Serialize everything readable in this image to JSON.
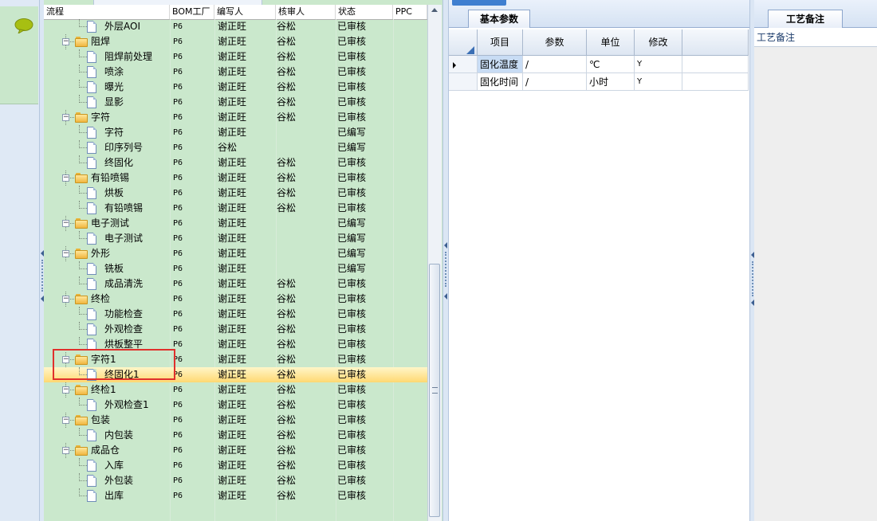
{
  "tree": {
    "columns": [
      "流程",
      "BOM工厂",
      "编写人",
      "核审人",
      "状态",
      "PPC"
    ],
    "rows": [
      {
        "name": "外层AOI",
        "level": 1,
        "type": "doc",
        "bom": "P6",
        "author": "谢正旺",
        "reviewer": "谷松",
        "status": "已审核"
      },
      {
        "name": "阻焊",
        "level": 0,
        "type": "folder",
        "bom": "P6",
        "author": "谢正旺",
        "reviewer": "谷松",
        "status": "已审核"
      },
      {
        "name": "阻焊前处理",
        "level": 1,
        "type": "doc",
        "bom": "P6",
        "author": "谢正旺",
        "reviewer": "谷松",
        "status": "已审核"
      },
      {
        "name": "喷涂",
        "level": 1,
        "type": "doc",
        "bom": "P6",
        "author": "谢正旺",
        "reviewer": "谷松",
        "status": "已审核"
      },
      {
        "name": "曝光",
        "level": 1,
        "type": "doc",
        "bom": "P6",
        "author": "谢正旺",
        "reviewer": "谷松",
        "status": "已审核"
      },
      {
        "name": "显影",
        "level": 1,
        "type": "doc",
        "bom": "P6",
        "author": "谢正旺",
        "reviewer": "谷松",
        "status": "已审核"
      },
      {
        "name": "字符",
        "level": 0,
        "type": "folder",
        "bom": "P6",
        "author": "谢正旺",
        "reviewer": "谷松",
        "status": "已审核"
      },
      {
        "name": "字符",
        "level": 1,
        "type": "doc",
        "bom": "P6",
        "author": "谢正旺",
        "reviewer": "",
        "status": "已编写"
      },
      {
        "name": "印序列号",
        "level": 1,
        "type": "doc",
        "bom": "P6",
        "author": "谷松",
        "reviewer": "",
        "status": "已编写"
      },
      {
        "name": "终固化",
        "level": 1,
        "type": "doc",
        "bom": "P6",
        "author": "谢正旺",
        "reviewer": "谷松",
        "status": "已审核"
      },
      {
        "name": "有铅喷锡",
        "level": 0,
        "type": "folder",
        "bom": "P6",
        "author": "谢正旺",
        "reviewer": "谷松",
        "status": "已审核"
      },
      {
        "name": "烘板",
        "level": 1,
        "type": "doc",
        "bom": "P6",
        "author": "谢正旺",
        "reviewer": "谷松",
        "status": "已审核"
      },
      {
        "name": "有铅喷锡",
        "level": 1,
        "type": "doc",
        "bom": "P6",
        "author": "谢正旺",
        "reviewer": "谷松",
        "status": "已审核"
      },
      {
        "name": "电子测试",
        "level": 0,
        "type": "folder",
        "bom": "P6",
        "author": "谢正旺",
        "reviewer": "",
        "status": "已编写"
      },
      {
        "name": "电子测试",
        "level": 1,
        "type": "doc",
        "bom": "P6",
        "author": "谢正旺",
        "reviewer": "",
        "status": "已编写"
      },
      {
        "name": "外形",
        "level": 0,
        "type": "folder",
        "bom": "P6",
        "author": "谢正旺",
        "reviewer": "",
        "status": "已编写"
      },
      {
        "name": "铣板",
        "level": 1,
        "type": "doc",
        "bom": "P6",
        "author": "谢正旺",
        "reviewer": "",
        "status": "已编写"
      },
      {
        "name": "成品清洗",
        "level": 1,
        "type": "doc",
        "bom": "P6",
        "author": "谢正旺",
        "reviewer": "谷松",
        "status": "已审核"
      },
      {
        "name": "终检",
        "level": 0,
        "type": "folder",
        "bom": "P6",
        "author": "谢正旺",
        "reviewer": "谷松",
        "status": "已审核"
      },
      {
        "name": "功能检查",
        "level": 1,
        "type": "doc",
        "bom": "P6",
        "author": "谢正旺",
        "reviewer": "谷松",
        "status": "已审核"
      },
      {
        "name": "外观检查",
        "level": 1,
        "type": "doc",
        "bom": "P6",
        "author": "谢正旺",
        "reviewer": "谷松",
        "status": "已审核"
      },
      {
        "name": "烘板整平",
        "level": 1,
        "type": "doc",
        "bom": "P6",
        "author": "谢正旺",
        "reviewer": "谷松",
        "status": "已审核"
      },
      {
        "name": "字符1",
        "level": 0,
        "type": "folder",
        "bom": "P6",
        "author": "谢正旺",
        "reviewer": "谷松",
        "status": "已审核"
      },
      {
        "name": "终固化1",
        "level": 1,
        "type": "doc",
        "bom": "P6",
        "author": "谢正旺",
        "reviewer": "谷松",
        "status": "已审核",
        "selected": true
      },
      {
        "name": "终检1",
        "level": 0,
        "type": "folder",
        "bom": "P6",
        "author": "谢正旺",
        "reviewer": "谷松",
        "status": "已审核"
      },
      {
        "name": "外观检查1",
        "level": 1,
        "type": "doc",
        "bom": "P6",
        "author": "谢正旺",
        "reviewer": "谷松",
        "status": "已审核"
      },
      {
        "name": "包装",
        "level": 0,
        "type": "folder",
        "bom": "P6",
        "author": "谢正旺",
        "reviewer": "谷松",
        "status": "已审核"
      },
      {
        "name": "内包装",
        "level": 1,
        "type": "doc",
        "bom": "P6",
        "author": "谢正旺",
        "reviewer": "谷松",
        "status": "已审核"
      },
      {
        "name": "成品仓",
        "level": 0,
        "type": "folder",
        "bom": "P6",
        "author": "谢正旺",
        "reviewer": "谷松",
        "status": "已审核"
      },
      {
        "name": "入库",
        "level": 1,
        "type": "doc",
        "bom": "P6",
        "author": "谢正旺",
        "reviewer": "谷松",
        "status": "已审核"
      },
      {
        "name": "外包装",
        "level": 1,
        "type": "doc",
        "bom": "P6",
        "author": "谢正旺",
        "reviewer": "谷松",
        "status": "已审核"
      },
      {
        "name": "出库",
        "level": 1,
        "type": "doc",
        "bom": "P6",
        "author": "谢正旺",
        "reviewer": "谷松",
        "status": "已审核"
      }
    ]
  },
  "params": {
    "tab_label": "基本参数",
    "columns": [
      "项目",
      "参数",
      "单位",
      "修改"
    ],
    "rows": [
      {
        "item": "固化温度",
        "param": "/",
        "unit": "℃",
        "modify": "Y",
        "selected": true
      },
      {
        "item": "固化时间",
        "param": "/",
        "unit": "小时",
        "modify": "Y"
      }
    ]
  },
  "notes": {
    "tab_label": "工艺备注",
    "label": "工艺备注"
  },
  "colors": {
    "tree_bg": "#cae8cc",
    "selection": "#ffd872",
    "highlight_border": "#e0302c",
    "accent": "#3b6fb5"
  },
  "icons": [
    "chat-bubble-icon",
    "folder-icon",
    "document-icon",
    "expander-minus-icon",
    "scroll-up-icon",
    "row-indicator-icon"
  ]
}
